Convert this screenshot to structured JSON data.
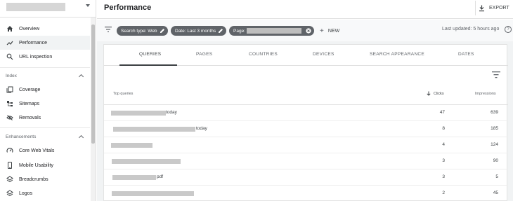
{
  "app": {
    "colors": {
      "accent": "#5f6368",
      "chip_bg": "#5f6368",
      "active_nav_bg": "#f1f3f4"
    }
  },
  "sidebar": {
    "nav_top": [
      {
        "label": "Overview",
        "icon": "home-icon"
      },
      {
        "label": "Performance",
        "icon": "trending-up-icon",
        "active": true
      },
      {
        "label": "URL inspection",
        "icon": "search-icon"
      }
    ],
    "index_section": {
      "title": "Index",
      "items": [
        {
          "label": "Coverage",
          "icon": "copy-icon"
        },
        {
          "label": "Sitemaps",
          "icon": "sitemap-icon"
        },
        {
          "label": "Removals",
          "icon": "eye-off-icon"
        }
      ]
    },
    "enhancements_section": {
      "title": "Enhancements",
      "items": [
        {
          "label": "Core Web Vitals",
          "icon": "speedometer-icon"
        },
        {
          "label": "Mobile Usability",
          "icon": "phone-icon"
        },
        {
          "label": "Breadcrumbs",
          "icon": "layers-icon"
        },
        {
          "label": "Logos",
          "icon": "layers-icon"
        }
      ]
    }
  },
  "header": {
    "title": "Performance",
    "export_label": "EXPORT"
  },
  "filters": {
    "chips": [
      {
        "label": "Search type: Web"
      },
      {
        "label": "Date: Last 3 months"
      },
      {
        "label": "Page: "
      }
    ],
    "new_label": "NEW",
    "last_updated": "Last updated: 5 hours ago",
    "help_glyph": "?"
  },
  "tabs": [
    "QUERIES",
    "PAGES",
    "COUNTRIES",
    "DEVICES",
    "SEARCH APPEARANCE",
    "DATES"
  ],
  "table": {
    "headers": {
      "query": "Top queries",
      "clicks": "Clicks",
      "impressions": "Impressions"
    },
    "rows": [
      {
        "query_suffix": "today",
        "clicks": "47",
        "impressions": "639"
      },
      {
        "query_suffix": "today",
        "clicks": "8",
        "impressions": "185"
      },
      {
        "query_suffix": "",
        "clicks": "4",
        "impressions": "124"
      },
      {
        "query_suffix": "",
        "clicks": "3",
        "impressions": "90"
      },
      {
        "query_suffix": "pdf",
        "clicks": "3",
        "impressions": "5"
      },
      {
        "query_suffix": "",
        "clicks": "2",
        "impressions": "45"
      }
    ]
  }
}
